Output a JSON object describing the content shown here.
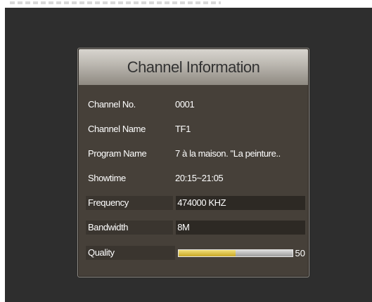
{
  "dialog": {
    "title": "Channel Information"
  },
  "fields": {
    "channel_no": {
      "label": "Channel No.",
      "value": "0001"
    },
    "channel_name": {
      "label": "Channel Name",
      "value": "TF1"
    },
    "program_name": {
      "label": "Program Name",
      "value": "7 à la maison. \"La peinture.."
    },
    "showtime": {
      "label": "Showtime",
      "value": "20:15~21:05"
    },
    "frequency": {
      "label": "Frequency",
      "value": "474000 KHZ"
    },
    "bandwidth": {
      "label": "Bandwidth",
      "value": "8M"
    },
    "quality": {
      "label": "Quality",
      "value": "50",
      "level_percent": 50
    }
  },
  "colors": {
    "screen_bg": "#2e2e2e",
    "dialog_bg": "#464039",
    "quality_fill": "#d9bf3c"
  }
}
